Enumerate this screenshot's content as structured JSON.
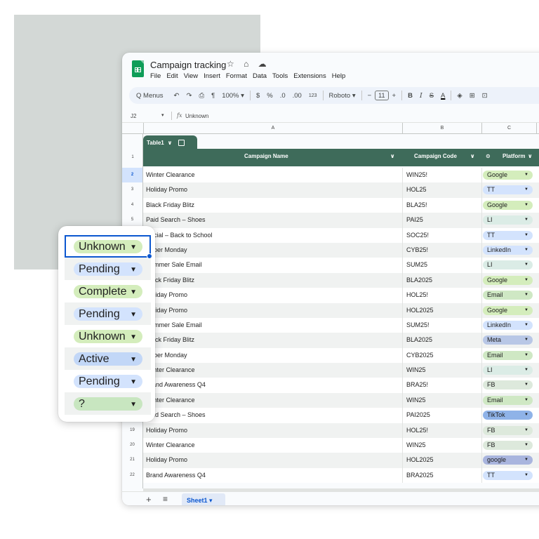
{
  "app": {
    "doc_title": "Campaign tracking",
    "title_icons": [
      "star-icon",
      "folder-move-icon",
      "cloud-status-icon"
    ],
    "title_icon_glyphs": "☆ ⌂ ☁",
    "menu": [
      "File",
      "Edit",
      "View",
      "Insert",
      "Format",
      "Data",
      "Tools",
      "Extensions",
      "Help"
    ]
  },
  "toolbar": {
    "search_icon": "Q",
    "menus_label": "Menus",
    "undo": "↶",
    "redo": "↷",
    "print": "⎙",
    "paint_format": "¶",
    "zoom": "100%",
    "zoom_arrow": "▾",
    "currency": "$",
    "percent": "%",
    "dec_decrease": ".0",
    "dec_increase": ".00",
    "number_format": "123",
    "font": "Roboto",
    "font_arrow": "▾",
    "minus": "−",
    "font_size": "11",
    "plus": "+",
    "bold": "B",
    "italic": "I",
    "strikethrough": "S",
    "text_color": "A",
    "fill_color": "◈",
    "borders": "⊞",
    "merge": "⊡"
  },
  "formula_bar": {
    "cell_ref": "J2",
    "ref_arrow": "▾",
    "fx": "fx",
    "value": "Unknown"
  },
  "columns": [
    "A",
    "B",
    "C"
  ],
  "table": {
    "name": "Table1",
    "name_arrow": "∨",
    "headers": {
      "name": "Campaign Name",
      "code": "Campaign Code",
      "platform": "Platform",
      "arrow": "∨",
      "platform_icon": "⊙"
    },
    "header_row_num": "1",
    "rows": [
      {
        "num": "2",
        "name": "Winter Clearance",
        "code": "WIN25!",
        "platform": "Google",
        "color": "#d4edbc"
      },
      {
        "num": "3",
        "name": "Holiday Promo",
        "code": "HOL25",
        "platform": "TT",
        "color": "#d3e3fd"
      },
      {
        "num": "4",
        "name": "Black Friday Blitz",
        "code": "BLA25!",
        "platform": "Google",
        "color": "#d4edbc"
      },
      {
        "num": "5",
        "name": "Paid Search – Shoes",
        "code": "PAI25",
        "platform": "LI",
        "color": "#dbece6"
      },
      {
        "num": "",
        "name": "Social – Back to School",
        "code": "SOC25!",
        "platform": "TT",
        "color": "#d3e3fd"
      },
      {
        "num": "",
        "name": "Cyber Monday",
        "code": "CYB25!",
        "platform": "LinkedIn",
        "color": "#d3e3fd"
      },
      {
        "num": "",
        "name": "Summer Sale Email",
        "code": "SUM25",
        "platform": "LI",
        "color": "#dbece6"
      },
      {
        "num": "",
        "name": "Black Friday Blitz",
        "code": "BLA2025",
        "platform": "Google",
        "color": "#d4edbc"
      },
      {
        "num": "",
        "name": "Holiday Promo",
        "code": "HOL25!",
        "platform": "Email",
        "color": "#cfe8c4"
      },
      {
        "num": "",
        "name": "Holiday Promo",
        "code": "HOL2025",
        "platform": "Google",
        "color": "#d4edbc"
      },
      {
        "num": "",
        "name": "Summer Sale Email",
        "code": "SUM25!",
        "platform": "LinkedIn",
        "color": "#d3e3fd"
      },
      {
        "num": "",
        "name": "Black Friday Blitz",
        "code": "BLA2025",
        "platform": "Meta",
        "color": "#b8c7e6"
      },
      {
        "num": "",
        "name": "Cyber Monday",
        "code": "CYB2025",
        "platform": "Email",
        "color": "#cfe8c4"
      },
      {
        "num": "",
        "name": "Winter Clearance",
        "code": "WIN25",
        "platform": "LI",
        "color": "#dbece6"
      },
      {
        "num": "",
        "name": "Brand Awareness Q4",
        "code": "BRA25!",
        "platform": "FB",
        "color": "#dde9dc"
      },
      {
        "num": "",
        "name": "Winter Clearance",
        "code": "WIN25",
        "platform": "Email",
        "color": "#cfe8c4"
      },
      {
        "num": "",
        "name": "Paid Search – Shoes",
        "code": "PAI2025",
        "platform": "TikTok",
        "color": "#8fb3e8"
      },
      {
        "num": "19",
        "name": "Holiday Promo",
        "code": "HOL25!",
        "platform": "FB",
        "color": "#dde9dc"
      },
      {
        "num": "20",
        "name": "Winter Clearance",
        "code": "WIN25",
        "platform": "FB",
        "color": "#dde9dc"
      },
      {
        "num": "21",
        "name": "Holiday Promo",
        "code": "HOL2025",
        "platform": "google",
        "color": "#a9b5de"
      },
      {
        "num": "22",
        "name": "Brand Awareness Q4",
        "code": "BRA2025",
        "platform": "TT",
        "color": "#d3e3fd"
      }
    ]
  },
  "sheet_bar": {
    "add": "+",
    "all_sheets": "≡",
    "tab": "Sheet1",
    "tab_arrow": "▾"
  },
  "status_card": {
    "items": [
      {
        "label": "Unknown",
        "color": "#d4edbc",
        "active": true
      },
      {
        "label": "Pending",
        "color": "#d3e3fd",
        "active": false
      },
      {
        "label": "Complete",
        "color": "#d4edbc",
        "active": false
      },
      {
        "label": "Pending",
        "color": "#d3e3fd",
        "active": false
      },
      {
        "label": "Unknown",
        "color": "#d4edbc",
        "active": false
      },
      {
        "label": "Active",
        "color": "#c2d7f7",
        "active": false
      },
      {
        "label": "Pending",
        "color": "#d3e3fd",
        "active": false
      },
      {
        "label": "?",
        "color": "#c8e6c0",
        "active": false
      }
    ],
    "dropdown_arrow": "▼"
  },
  "colors": {
    "table_header": "#3e6b5a",
    "selection": "#0b57d0",
    "bg_panel": "#d3d8d6"
  }
}
